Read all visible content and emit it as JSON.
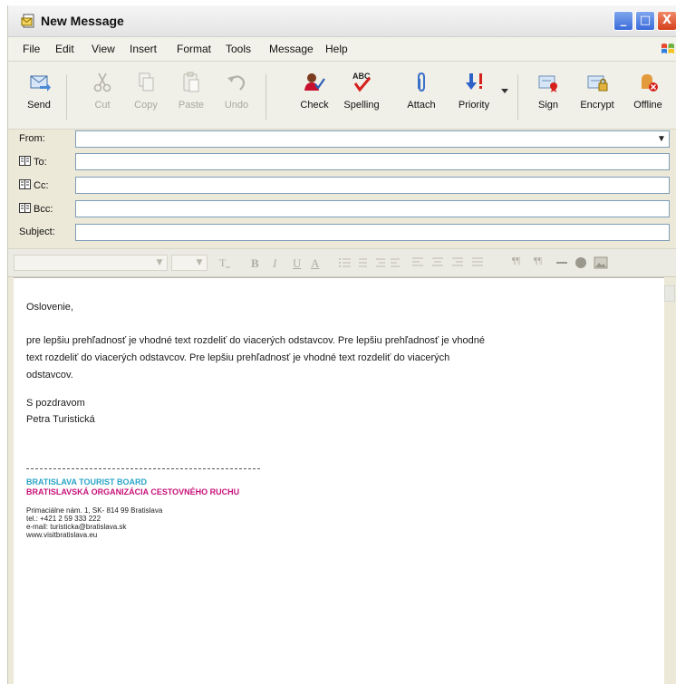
{
  "window": {
    "title": "New Message",
    "controls": {
      "minimize": "_",
      "maximize": "□",
      "close": "X"
    }
  },
  "menu": [
    "File",
    "Edit",
    "View",
    "Insert",
    "Format",
    "Tools",
    "Message",
    "Help"
  ],
  "toolbar": {
    "send": "Send",
    "cut": "Cut",
    "copy": "Copy",
    "paste": "Paste",
    "undo": "Undo",
    "check": "Check",
    "spelling": "Spelling",
    "attach": "Attach",
    "priority": "Priority",
    "sign": "Sign",
    "encrypt": "Encrypt",
    "offline": "Offline"
  },
  "fields": {
    "from_label": "From:",
    "to_label": "To:",
    "cc_label": "Cc:",
    "bcc_label": "Bcc:",
    "subject_label": "Subject:",
    "from_value": "",
    "to_value": "",
    "cc_value": "",
    "bcc_value": "",
    "subject_value": ""
  },
  "format_toolbar": {
    "bold": "B",
    "italic": "I",
    "underline": "U",
    "font_color": "A"
  },
  "message": {
    "greeting": "Oslovenie,",
    "paragraph": "pre lepšiu prehľadnosť je vhodné text rozdeliť do viacerých odstavcov. Pre lepšiu prehľadnosť je vhodné text rozdeliť do viacerých odstavcov. Pre lepšiu prehľadnosť je vhodné text rozdeliť do viacerých odstavcov.",
    "closing": "S pozdravom",
    "name": "Petra Turistická"
  },
  "signature": {
    "org_en": "BRATISLAVA TOURIST BOARD",
    "org_sk": "BRATISLAVSKÁ ORGANIZÁCIA CESTOVNÉHO RUCHU",
    "address": "Primaciálne nám. 1, SK- 814 99 Bratislava",
    "phone": "tel.: +421 2 59 333 222",
    "email": "e-mail: turisticka@bratislava.sk",
    "web": "www.visitbratislava.eu"
  },
  "colors": {
    "org_en": "#29a4c8",
    "org_sk": "#c8127a",
    "close_button": "#d6401b",
    "window_buttons": "#3a6ad9"
  }
}
